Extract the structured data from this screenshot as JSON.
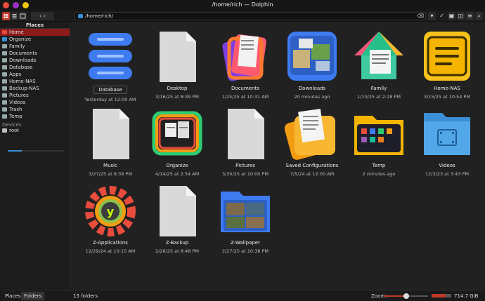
{
  "window": {
    "title": "/home/rich — Dolphin"
  },
  "toolbar": {
    "path": "/home/rich/",
    "nav_arrows": "‹ ›"
  },
  "sidebar": {
    "header": "Places",
    "items": [
      {
        "label": "Home",
        "icon": "home-icon",
        "color": "#e74c3c",
        "active": true
      },
      {
        "label": "Organize",
        "icon": "organize-icon",
        "color": "#3a8fd6"
      },
      {
        "label": "Family",
        "icon": "family-icon",
        "color": "#9aa"
      },
      {
        "label": "Documents",
        "icon": "documents-icon",
        "color": "#9aa"
      },
      {
        "label": "Downloads",
        "icon": "downloads-icon",
        "color": "#9aa"
      },
      {
        "label": "Database",
        "icon": "database-icon",
        "color": "#9aa"
      },
      {
        "label": "Apps",
        "icon": "apps-icon",
        "color": "#9aa"
      },
      {
        "label": "Home-NAS",
        "icon": "nas-icon",
        "color": "#9aa"
      },
      {
        "label": "Backup-NAS",
        "icon": "nas-icon",
        "color": "#9aa"
      },
      {
        "label": "Pictures",
        "icon": "pictures-icon",
        "color": "#9aa"
      },
      {
        "label": "Videos",
        "icon": "videos-icon",
        "color": "#9aa"
      },
      {
        "label": "Trash",
        "icon": "trash-icon",
        "color": "#9aa"
      },
      {
        "label": "Temp",
        "icon": "temp-icon",
        "color": "#9aa"
      }
    ],
    "devices_header": "Devices",
    "device": {
      "label": "root",
      "icon": "drive-icon",
      "usage_fraction": 0.25
    }
  },
  "folders": [
    {
      "name": "Database",
      "date": "Yesterday at 12:00 AM",
      "icon": "database-icon",
      "selected": true
    },
    {
      "name": "Desktop",
      "date": "3/16/25 at 8:39 PM",
      "icon": "blank-file-icon"
    },
    {
      "name": "Documents",
      "date": "1/25/25 at 10:31 AM",
      "icon": "documents-stack-icon"
    },
    {
      "name": "Downloads",
      "date": "20 minutes ago",
      "icon": "downloads-folder-icon"
    },
    {
      "name": "Family",
      "date": "1/10/25 at 2:28 PM",
      "icon": "family-house-icon"
    },
    {
      "name": "Home-NAS",
      "date": "3/15/25 at 10:54 PM",
      "icon": "nas-list-icon"
    },
    {
      "name": "Music",
      "date": "3/27/25 at 9:39 PM",
      "icon": "blank-file-icon"
    },
    {
      "name": "Organize",
      "date": "4/14/25 at 2:54 AM",
      "icon": "organize-frame-icon"
    },
    {
      "name": "Pictures",
      "date": "3/30/25 at 10:00 PM",
      "icon": "blank-file-icon"
    },
    {
      "name": "Saved Configurations",
      "date": "7/5/24 at 12:00 AM",
      "icon": "config-folder-icon"
    },
    {
      "name": "Temp",
      "date": "2 minutes ago",
      "icon": "temp-folder-icon"
    },
    {
      "name": "Videos",
      "date": "12/3/23 at 3:43 PM",
      "icon": "video-folder-icon"
    },
    {
      "name": "Z-Applications",
      "date": "12/29/24 at 10:15 AM",
      "icon": "gear-app-icon"
    },
    {
      "name": "Z-Backup",
      "date": "2/26/25 at 8:48 PM",
      "icon": "blank-file-icon"
    },
    {
      "name": "Z-Wallpaper",
      "date": "2/27/25 at 10:38 PM",
      "icon": "wallpaper-folder-icon"
    }
  ],
  "statusbar": {
    "tab_places": "Places",
    "tab_folders": "Folders",
    "count": "15 folders",
    "zoom_label": "Zoom:",
    "zoom_fraction": 0.5,
    "space_used_fraction": 0.7,
    "free": "714.7 GiB free"
  },
  "colors": {
    "accent": "#c0392b",
    "folder_blue": "#3a8fd6"
  }
}
